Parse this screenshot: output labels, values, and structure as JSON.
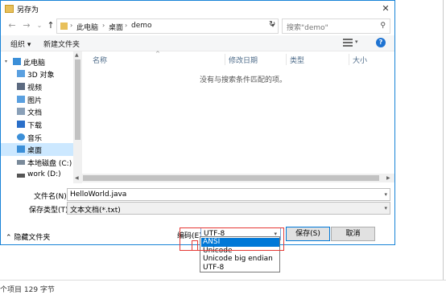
{
  "dialog": {
    "title": "另存为",
    "close_label": "✕"
  },
  "nav": {
    "back": "←",
    "forward": "→",
    "recent": "⌄",
    "up": "↑",
    "path": [
      "此电脑",
      "桌面",
      "demo"
    ],
    "refresh": "↻",
    "search_placeholder": "搜索\"demo\""
  },
  "toolbar": {
    "organize": "组织 ▾",
    "new_folder": "新建文件夹",
    "help": "?"
  },
  "sidebar": {
    "items": [
      {
        "label": "此电脑",
        "icon": "computer-icon",
        "color": "#3b8fd8"
      },
      {
        "label": "3D 对象",
        "icon": "3d-objects-icon",
        "color": "#5aa0e0"
      },
      {
        "label": "视频",
        "icon": "video-icon",
        "color": "#5c6a80"
      },
      {
        "label": "图片",
        "icon": "pictures-icon",
        "color": "#5aa0e0"
      },
      {
        "label": "文档",
        "icon": "documents-icon",
        "color": "#8aa0b8"
      },
      {
        "label": "下载",
        "icon": "downloads-icon",
        "color": "#2a6fc9"
      },
      {
        "label": "音乐",
        "icon": "music-icon",
        "color": "#3b8fd8"
      },
      {
        "label": "桌面",
        "icon": "desktop-icon",
        "color": "#3b8fd8"
      },
      {
        "label": "本地磁盘 (C:)",
        "icon": "drive-icon",
        "color": "#7a8a9a"
      },
      {
        "label": "work (D:)",
        "icon": "drive-icon",
        "color": "#555555"
      }
    ],
    "active_index": 7
  },
  "columns": [
    "名称",
    "修改日期",
    "类型",
    "大小"
  ],
  "empty_message": "没有与搜索条件匹配的项。",
  "fields": {
    "filename_label": "文件名(N):",
    "filename_value": "HelloWorld.java",
    "filetype_label": "保存类型(T):",
    "filetype_value": "文本文档(*.txt)"
  },
  "bottom": {
    "hide_folders": "隐藏文件夹",
    "encoding_label": "编码(E):",
    "encoding_value": "UTF-8",
    "save": "保存(S)",
    "cancel": "取消"
  },
  "encoding_options": [
    "ANSI",
    "Unicode",
    "Unicode big endian",
    "UTF-8"
  ],
  "encoding_highlighted": "ANSI",
  "status": "个项目  129 字节",
  "colors": {
    "accent": "#0078d7",
    "highlight_box": "#e53935",
    "sidebar_selected": "#cce8ff"
  }
}
